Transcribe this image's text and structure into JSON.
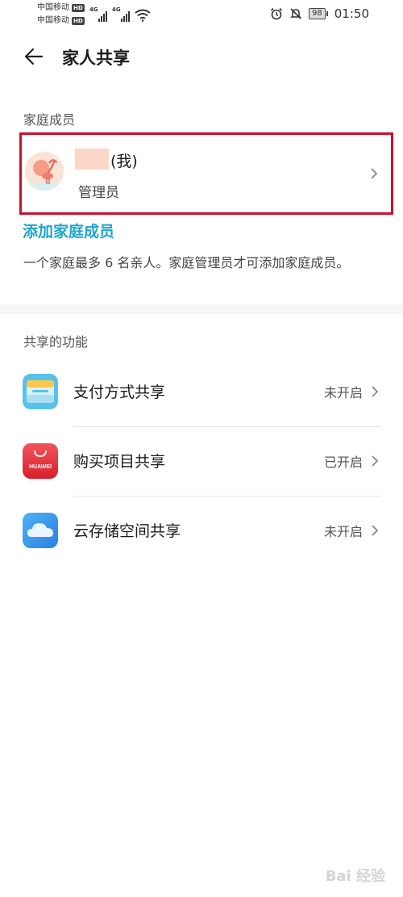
{
  "status_bar": {
    "carrier1": "中国移动",
    "carrier2": "中国移动",
    "hd": "HD",
    "network1": "4G",
    "network2": "4G",
    "battery": "98",
    "time": "01:50"
  },
  "header": {
    "title": "家人共享"
  },
  "members_section": {
    "title": "家庭成员",
    "member": {
      "name_suffix": "(我)",
      "role": "管理员"
    },
    "add_link": "添加家庭成员",
    "note": "一个家庭最多 6 名亲人。家庭管理员才可添加家庭成员。"
  },
  "features_section": {
    "title": "共享的功能",
    "items": [
      {
        "label": "支付方式共享",
        "state": "未开启",
        "icon": "wallet-icon"
      },
      {
        "label": "购买项目共享",
        "state": "已开启",
        "icon": "huawei-appgallery-icon",
        "icon_text": "HUAWEI"
      },
      {
        "label": "云存储空间共享",
        "state": "未开启",
        "icon": "cloud-icon"
      }
    ]
  },
  "watermark": "Bai 经验",
  "colors": {
    "accent": "#1fa5c9",
    "highlight_border": "#c8102e"
  }
}
